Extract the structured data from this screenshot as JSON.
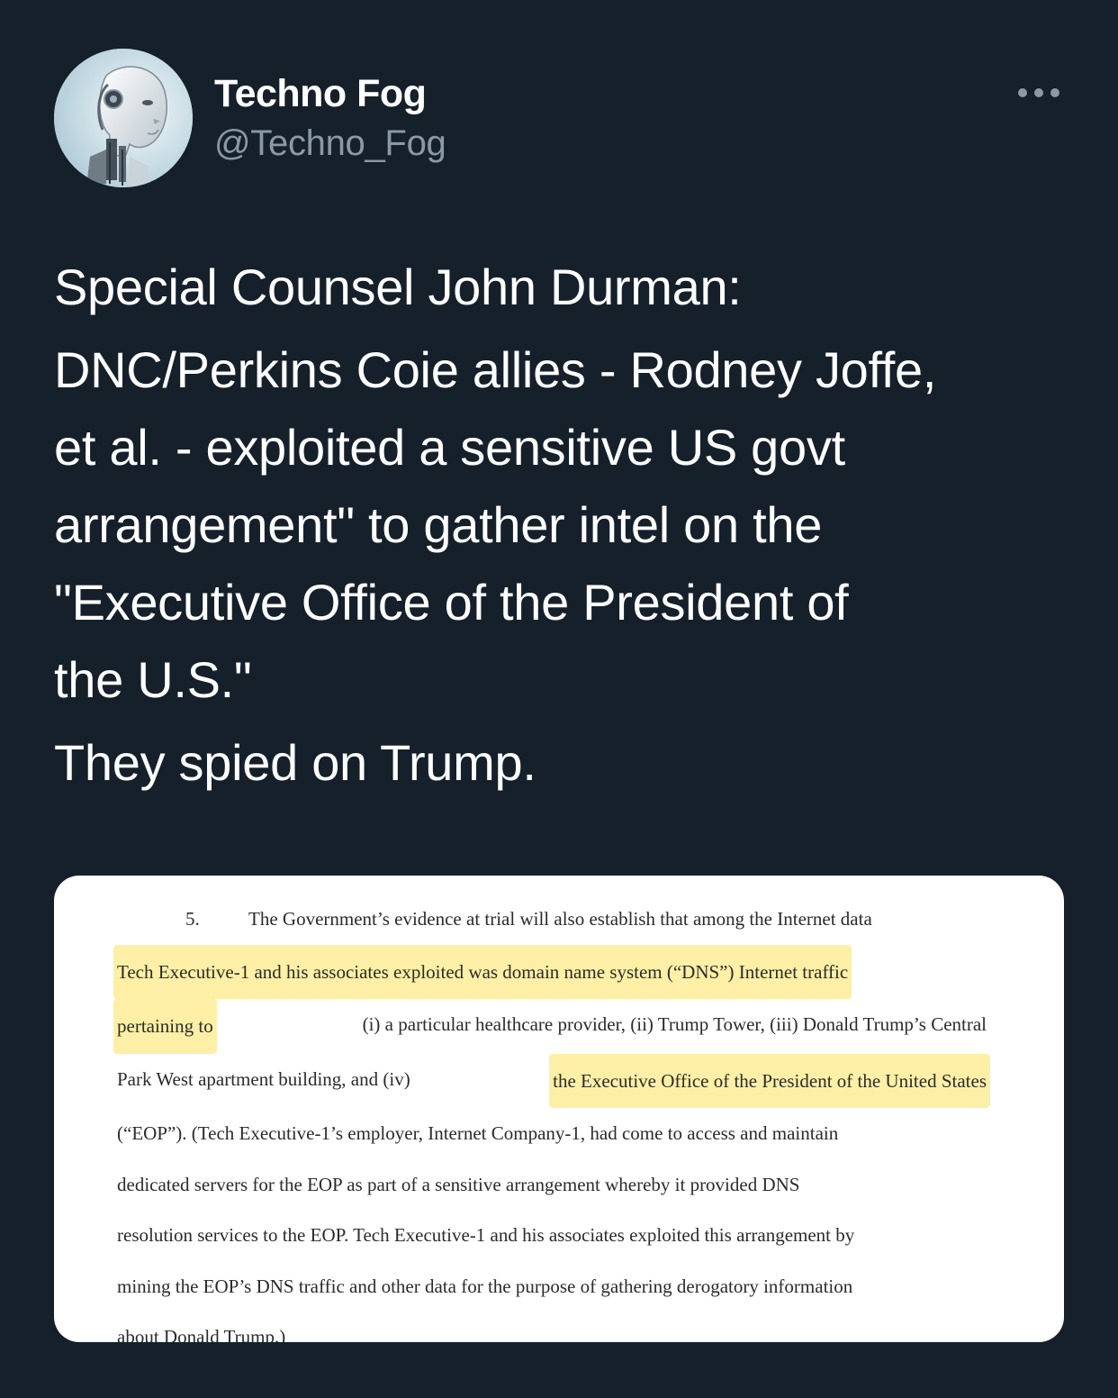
{
  "author": {
    "display_name": "Techno Fog",
    "handle": "@Techno_Fog",
    "avatar_icon": "robot-avatar"
  },
  "menu": {
    "icon": "more-horizontal-icon"
  },
  "tweet": {
    "paragraph_1": "Special Counsel John Durman:",
    "paragraph_2_lines": [
      "DNC/Perkins Coie allies - Rodney Joffe,",
      "et al. - exploited a sensitive US govt",
      "arrangement\" to gather intel on the",
      "\"Executive Office of the President of",
      "the U.S.\""
    ],
    "paragraph_3": "They spied on Trump."
  },
  "document": {
    "paragraph_number": "5.",
    "line_1": "The Government’s evidence at trial will also establish that among the Internet data",
    "line_2_highlight": "Tech Executive-1 and his associates exploited was domain name system (“DNS”) Internet traffic",
    "line_3_highlight": "pertaining to",
    "line_3_rest": "(i) a particular healthcare provider, (ii) Trump Tower, (iii) Donald Trump’s Central",
    "line_4_start": "Park West apartment building, and (iv)",
    "line_4_highlight": "the Executive Office of the President of the United States",
    "line_5": "(“EOP”).  (Tech Executive-1’s employer, Internet Company-1, had come to access and maintain",
    "line_6": "dedicated servers for the EOP as part of a sensitive arrangement whereby it provided DNS",
    "line_7": "resolution services to the EOP.  Tech Executive-1 and his associates exploited this arrangement by",
    "line_8": "mining the EOP’s DNS traffic and other data for the purpose of gathering derogatory information",
    "line_9": "about Donald Trump.)",
    "highlight_color": "#fdf0a6"
  },
  "colors": {
    "background": "#15202b",
    "text_primary": "#ffffff",
    "text_secondary": "#8b98a5"
  }
}
